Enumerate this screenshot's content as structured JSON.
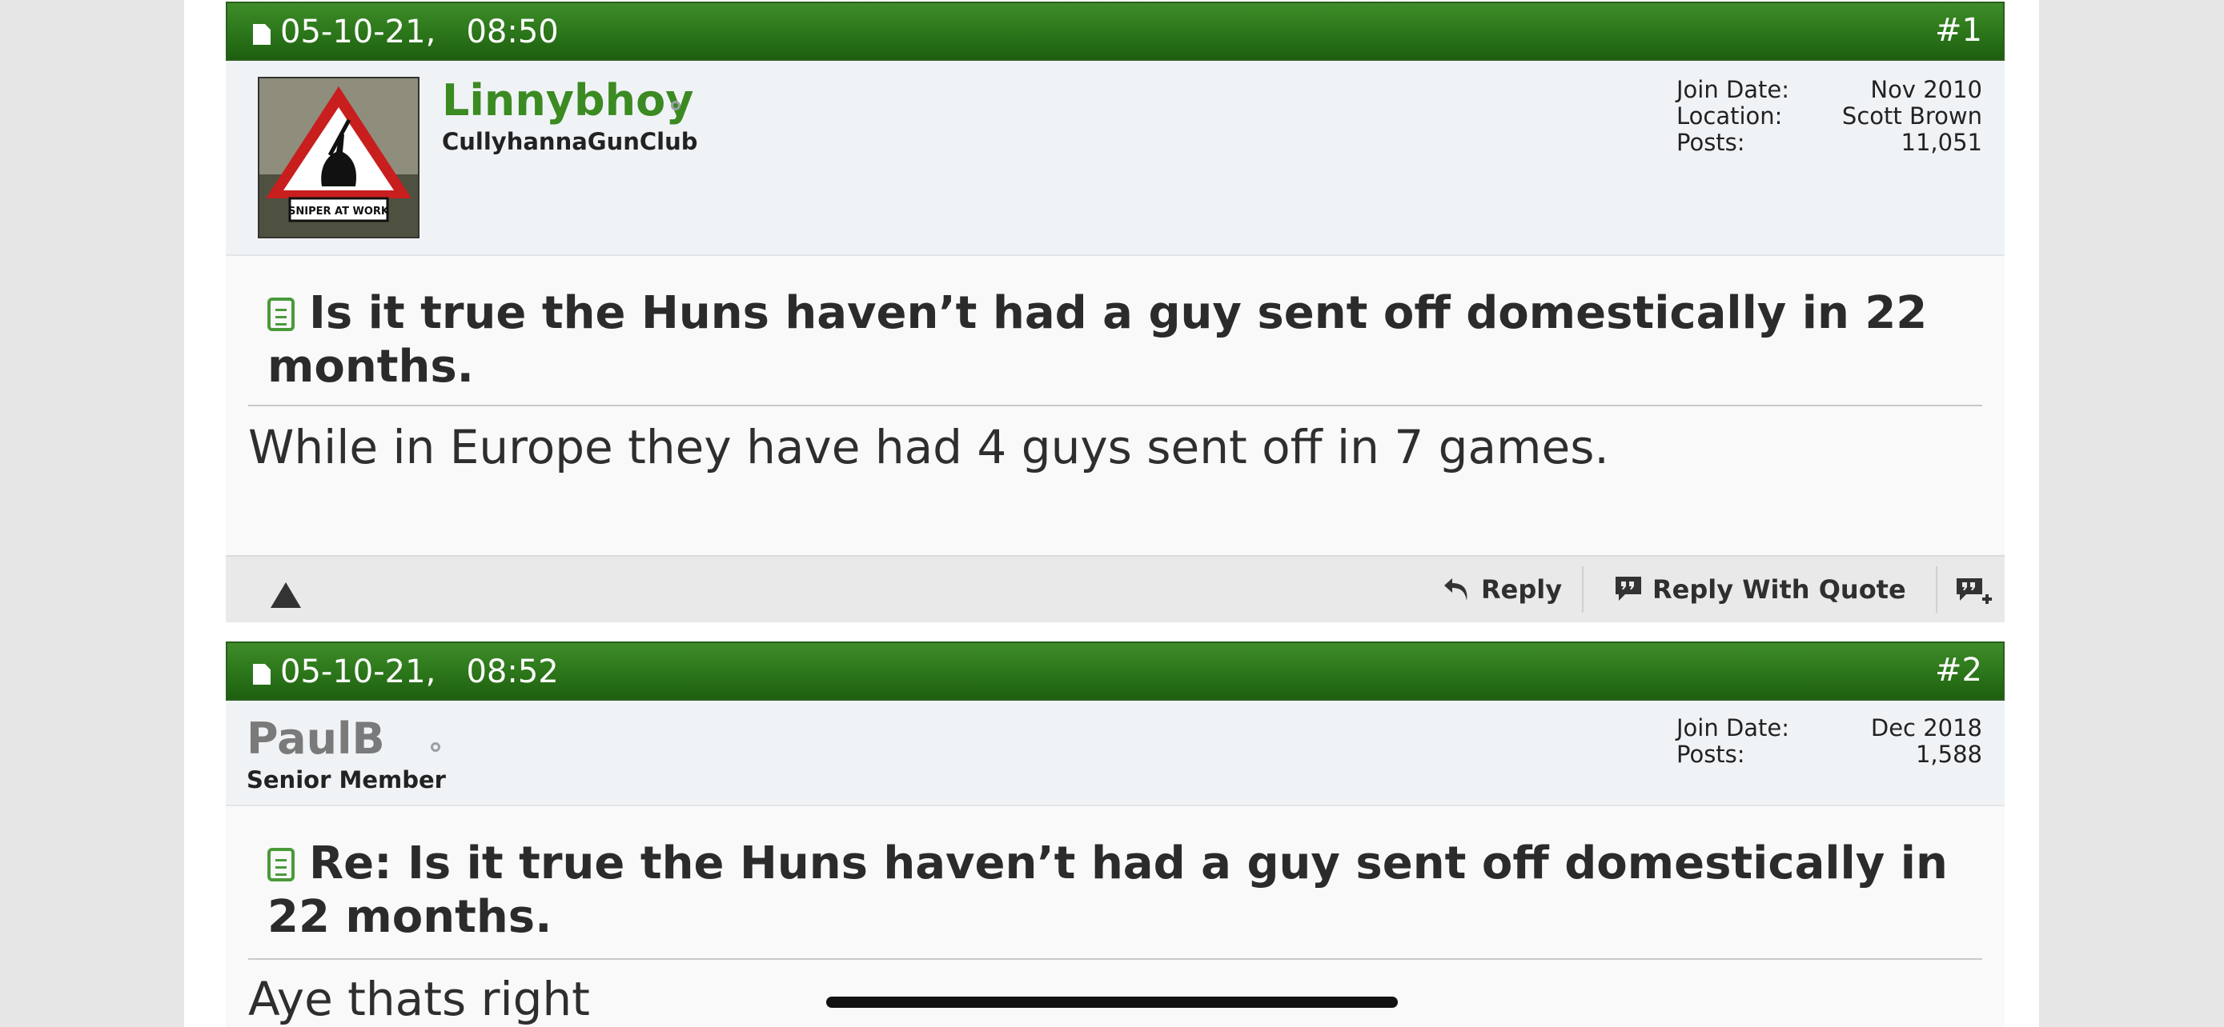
{
  "posts": [
    {
      "date": "05-10-21,",
      "time": "08:50",
      "number": "#1",
      "username": "Linnybhoy",
      "user_title": "CullyhannaGunClub",
      "avatar_text": "SNIPER AT WORK",
      "stats": [
        {
          "label": "Join Date:",
          "value": "Nov 2010"
        },
        {
          "label": "Location:",
          "value": "Scott Brown"
        },
        {
          "label": "Posts:",
          "value": "11,051"
        }
      ],
      "title": "Is it true the Huns haven’t had a guy sent off domestically in 22 months.",
      "message": "While in Europe they have had 4 guys sent off in 7 games.",
      "footer": {
        "reply_label": "Reply",
        "quote_label": "Reply With Quote"
      }
    },
    {
      "date": "05-10-21,",
      "time": "08:52",
      "number": "#2",
      "username": "PaulB",
      "user_title": "Senior Member",
      "stats": [
        {
          "label": "Join Date:",
          "value": "Dec 2018"
        },
        {
          "label": "Posts:",
          "value": "1,588"
        }
      ],
      "title": "Re: Is it true the Huns haven’t had a guy sent off domestically in 22 months.",
      "message": "Aye thats right"
    }
  ],
  "colors": {
    "header_green": "#2e7a1c",
    "username_green": "#3b8a22",
    "username_gray": "#7a7a7a",
    "icon_green": "#4a9a3a"
  }
}
